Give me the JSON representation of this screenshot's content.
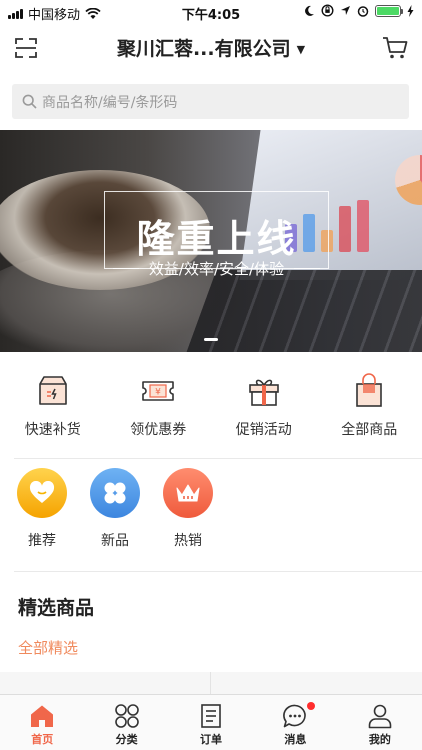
{
  "status_bar": {
    "carrier": "中国移动",
    "time": "下午4:05"
  },
  "header": {
    "title": "聚川汇蓉...有限公司"
  },
  "search": {
    "placeholder": "商品名称/编号/条形码"
  },
  "banner": {
    "title": "隆重上线",
    "subtitle": "效益/效率/安全/体验"
  },
  "quick_entries": [
    {
      "label": "快速补货",
      "icon": "restock-box-icon"
    },
    {
      "label": "领优惠券",
      "icon": "coupon-ticket-icon"
    },
    {
      "label": "促销活动",
      "icon": "gift-box-icon"
    },
    {
      "label": "全部商品",
      "icon": "shopping-bag-icon"
    }
  ],
  "categories": [
    {
      "label": "推荐",
      "icon": "heart-icon",
      "color": "#f5b400"
    },
    {
      "label": "新品",
      "icon": "four-leaf-icon",
      "color": "#4a90e2"
    },
    {
      "label": "热销",
      "icon": "crown-icon",
      "color": "#f26d4f"
    }
  ],
  "featured": {
    "title": "精选商品",
    "link": "全部精选"
  },
  "tabbar": [
    {
      "label": "首页",
      "icon": "home-icon",
      "active": true
    },
    {
      "label": "分类",
      "icon": "grid-circles-icon",
      "active": false
    },
    {
      "label": "订单",
      "icon": "order-list-icon",
      "active": false
    },
    {
      "label": "消息",
      "icon": "message-bubble-icon",
      "active": false,
      "badge": true
    },
    {
      "label": "我的",
      "icon": "profile-icon",
      "active": false
    }
  ],
  "colors": {
    "accent": "#f0674a",
    "link": "#f08a5d"
  }
}
